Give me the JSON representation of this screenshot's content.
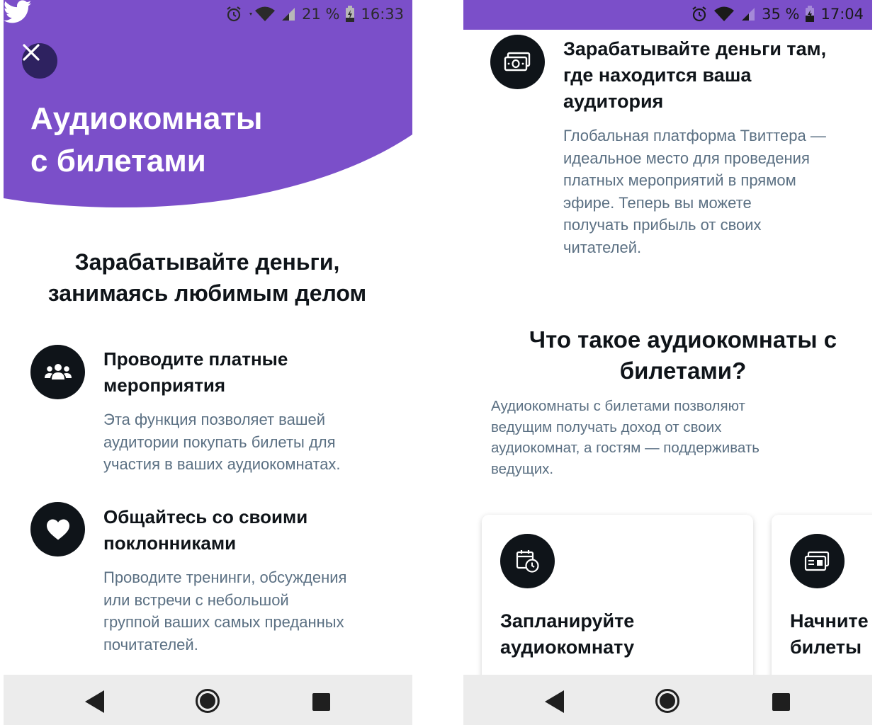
{
  "colors": {
    "purple": "#7b4fc9",
    "close_bg": "#2e2260",
    "text_primary": "#0f1419",
    "text_secondary": "#5b7083",
    "nav_bg": "#ececec"
  },
  "left": {
    "status": {
      "battery": "21 %",
      "time": "16:33"
    },
    "header": {
      "title_line1": "Аудиокомнаты",
      "title_line2": "с билетами"
    },
    "section_title_line1": "Зарабатывайте деньги,",
    "section_title_line2": "занимаясь любимым делом",
    "features": [
      {
        "icon": "people-icon",
        "title_line1": "Проводите платные",
        "title_line2": "мероприятия",
        "desc_line1": "Эта функция позволяет вашей",
        "desc_line2": "аудитории покупать билеты для",
        "desc_line3": "участия в ваших аудиокомнатах."
      },
      {
        "icon": "heart-icon",
        "title_line1": "Общайтесь со своими",
        "title_line2": "поклонниками",
        "desc_line1": "Проводите тренинги, обсуждения",
        "desc_line2": "или встречи с небольшой",
        "desc_line3": "группой ваших самых преданных",
        "desc_line4": "почитателей."
      }
    ]
  },
  "right": {
    "status": {
      "battery": "35 %",
      "time": "17:04"
    },
    "feature": {
      "icon": "money-icon",
      "title_line1": "Зарабатывайте деньги там,",
      "title_line2": "где находится ваша",
      "title_line3": "аудитория",
      "desc_line1": "Глобальная платформа Твиттера —",
      "desc_line2": "идеальное место для проведения",
      "desc_line3": "платных мероприятий в прямом",
      "desc_line4": "эфире. Теперь вы можете",
      "desc_line5": "получать прибыль от своих",
      "desc_line6": "читателей."
    },
    "section_title_line1": "Что такое аудиокомнаты с",
    "section_title_line2": "билетами?",
    "intro_line1": "Аудиокомнаты с билетами позволяют",
    "intro_line2": "ведущим получать доход от своих",
    "intro_line3": "аудиокомнат, а гостям — поддерживать",
    "intro_line4": "ведущих.",
    "cards": [
      {
        "icon": "calendar-clock-icon",
        "title_line1": "Запланируйте",
        "title_line2": "аудиокомнату"
      },
      {
        "icon": "ticket-icon",
        "title_line1": "Начните",
        "title_line2": "билеты"
      }
    ]
  }
}
